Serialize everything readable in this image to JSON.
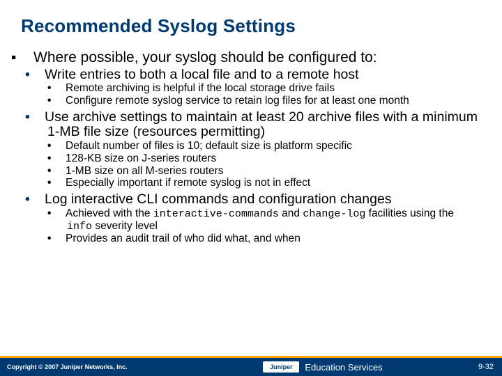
{
  "title": "Recommended Syslog Settings",
  "main": {
    "heading": "Where possible, your syslog should be configured to:",
    "items": [
      {
        "label": "Write entries to both a local file and to a remote host",
        "sub": [
          "Remote archiving is helpful if the local storage drive fails",
          "Configure remote syslog service to retain log files for at least one month"
        ]
      },
      {
        "label": "Use archive settings to maintain at least 20 archive files with a minimum 1-MB file size (resources permitting)",
        "sub": [
          "Default number of files is 10; default size is platform specific",
          "128-KB size on J-series routers",
          "1-MB size on all M-series routers",
          "Especially important if remote syslog is not in effect"
        ]
      },
      {
        "label": "Log interactive CLI commands and configuration changes",
        "sub": [
          "Achieved with the interactive-commands and change-log facilities using the info severity level",
          "Provides an audit trail of who did what, and when"
        ],
        "rich": true
      }
    ]
  },
  "rich_parts": {
    "pre": "Achieved with the ",
    "code1": "interactive-commands",
    "mid": " and ",
    "code2": "change-log",
    "post1": " facilities using the ",
    "code3": "info",
    "post2": " severity level"
  },
  "footer": {
    "copyright": "Copyright © 2007 Juniper Networks, Inc.",
    "logo_text": "Juniper",
    "service": "Education Services",
    "page": "9-32"
  }
}
